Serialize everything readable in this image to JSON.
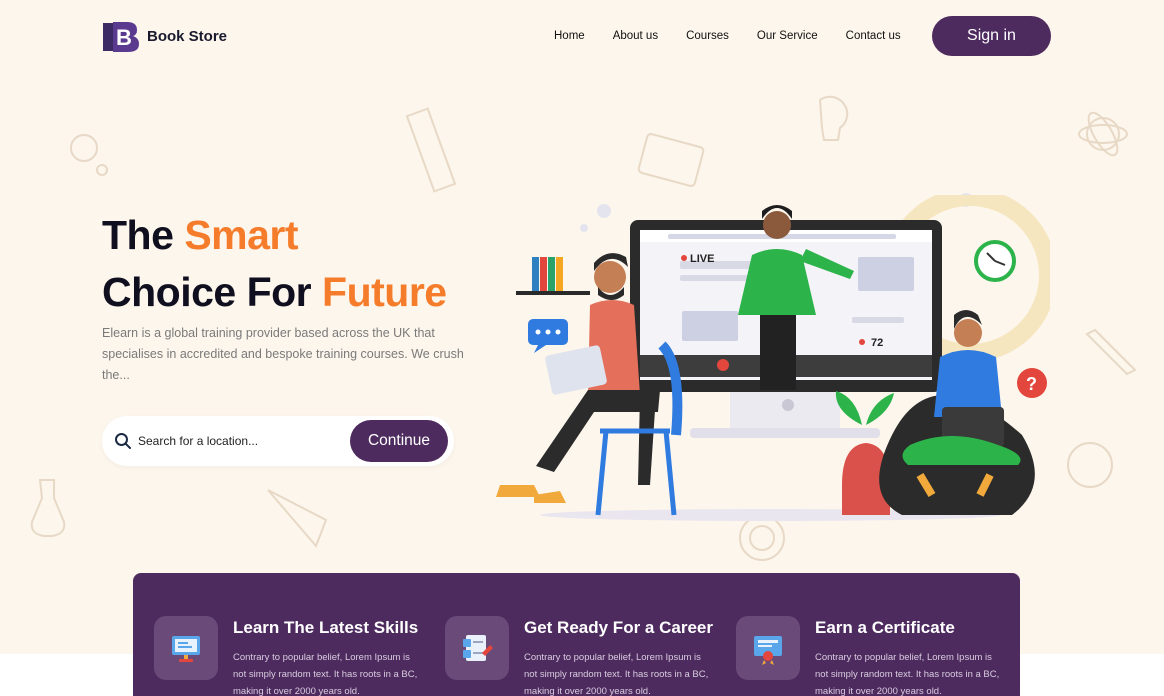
{
  "brand": {
    "name": "Book Store",
    "logo_letter": "B"
  },
  "nav": {
    "items": [
      "Home",
      "About us",
      "Courses",
      "Our Service",
      "Contact us"
    ],
    "signin_label": "Sign in"
  },
  "hero": {
    "title_word1": "The",
    "title_accent1": "Smart",
    "title_line2": "Choice For",
    "title_accent2": "Future",
    "description": "Elearn is a global training provider based across the UK that specialises in accredited and bespoke training courses. We crush the...",
    "search_placeholder": "Search for a location...",
    "continue_label": "Continue"
  },
  "illustration": {
    "live_label": "LIVE",
    "viewer_count": "72"
  },
  "features": [
    {
      "title": "Learn The Latest Skills",
      "text": "Contrary to popular belief, Lorem Ipsum is not simply random text. It has roots in a BC, making it over 2000 years old.",
      "icon": "monitor-presentation-icon"
    },
    {
      "title": "Get Ready For a Career",
      "text": "Contrary to popular belief, Lorem Ipsum is not simply random text. It has roots in a BC, making it over 2000 years old.",
      "icon": "checklist-document-icon"
    },
    {
      "title": "Earn a Certificate",
      "text": "Contrary to popular belief, Lorem Ipsum is not simply random text. It has roots in a BC, making it over 2000 years old.",
      "icon": "certificate-icon"
    }
  ],
  "colors": {
    "primary": "#4e2b5f",
    "accent": "#f57c2a",
    "background": "#fdf6ec"
  }
}
